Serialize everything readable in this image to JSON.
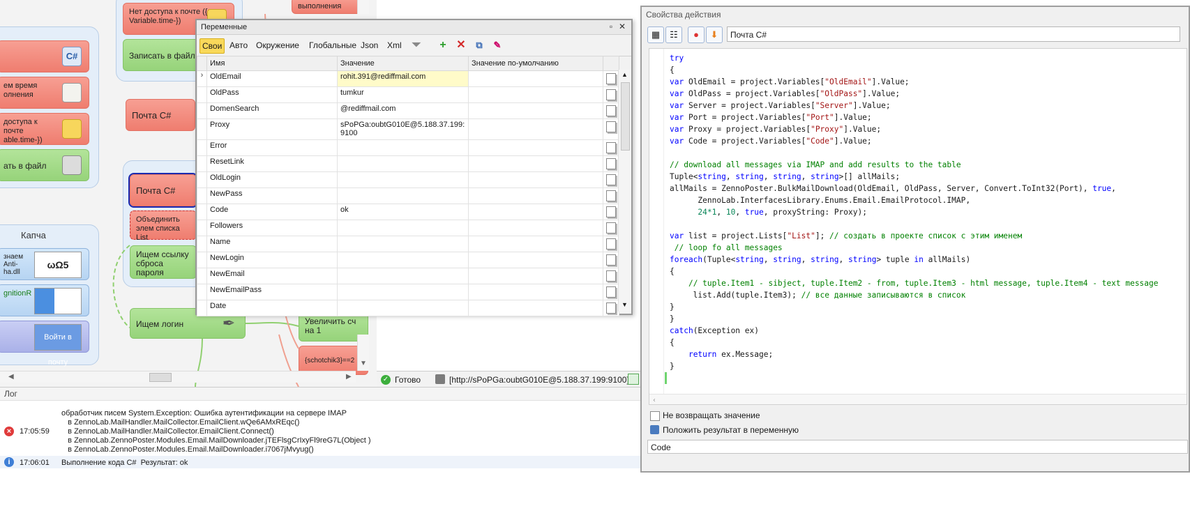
{
  "canvas": {
    "blocks": {
      "no_access_top": "Нет доступа к почте ({-Variable.time-})",
      "write_file_1": "Записать в файл",
      "execute_top": "выполнения",
      "remember_time": "ем время олнения",
      "no_access_left": "доступа к почте able.time-})",
      "write_file_left": "ать в файл",
      "mail_cs_1": "Почта C#",
      "mail_cs_2": "Почта C#",
      "merge_list": "Объединить элем списка List",
      "find_reset": "Ищем ссылку сброса пароля",
      "find_login": "Ищем логин",
      "increment": "Увеличить сч на 1",
      "condition": "{schotchik3}==2",
      "anti_captcha": "знаем Anti- ha.dll",
      "recognition": "gnitionR",
      "login_mail": "Войти в почту"
    },
    "group_captcha_title": "Капча"
  },
  "status": {
    "ready": "Готово",
    "proxy": "[http://sPoPGa:oubtG010E@5.188.37.199:9100]"
  },
  "variables_window": {
    "title": "Переменные",
    "tabs": [
      "Свои",
      "Авто",
      "Окружение",
      "Глобальные",
      "Json",
      "Xml"
    ],
    "columns": [
      "Имя",
      "Значение",
      "Значение по-умолчанию"
    ],
    "rows": [
      {
        "name": "OldEmail",
        "value": "rohit.391@rediffmail.com",
        "default": ""
      },
      {
        "name": "OldPass",
        "value": "tumkur",
        "default": ""
      },
      {
        "name": "DomenSearch",
        "value": "@rediffmail.com",
        "default": ""
      },
      {
        "name": "Proxy",
        "value": "sPoPGa:oubtG010E@5.188.37.199:9100",
        "default": ""
      },
      {
        "name": "Error",
        "value": "",
        "default": ""
      },
      {
        "name": "ResetLink",
        "value": "",
        "default": ""
      },
      {
        "name": "OldLogin",
        "value": "",
        "default": ""
      },
      {
        "name": "NewPass",
        "value": "",
        "default": ""
      },
      {
        "name": "Code",
        "value": "ok",
        "default": ""
      },
      {
        "name": "Followers",
        "value": "",
        "default": ""
      },
      {
        "name": "Name",
        "value": "",
        "default": ""
      },
      {
        "name": "NewLogin",
        "value": "",
        "default": ""
      },
      {
        "name": "NewEmail",
        "value": "",
        "default": ""
      },
      {
        "name": "NewEmailPass",
        "value": "",
        "default": ""
      },
      {
        "name": "Date",
        "value": "",
        "default": ""
      }
    ]
  },
  "properties": {
    "title": "Свойства действия",
    "action_name": "Почта C#",
    "code_lines": [
      "try",
      "{",
      "var OldEmail = project.Variables[\"OldEmail\"].Value;",
      "var OldPass = project.Variables[\"OldPass\"].Value;",
      "var Server = project.Variables[\"Server\"].Value;",
      "var Port = project.Variables[\"Port\"].Value;",
      "var Proxy = project.Variables[\"Proxy\"].Value;",
      "var Code = project.Variables[\"Code\"].Value;",
      "",
      "// download all messages via IMAP and add results to the table",
      "Tuple<string, string, string, string>[] allMails;",
      "allMails = ZennoPoster.BulkMailDownload(OldEmail, OldPass, Server, Convert.ToInt32(Port), true,",
      "      ZennoLab.InterfacesLibrary.Enums.Email.EmailProtocol.IMAP,",
      "      24*1, 10, true, proxyString: Proxy);",
      "",
      "var list = project.Lists[\"List\"]; // создать в проекте список с этим именем",
      " // loop fo all messages",
      "foreach(Tuple<string, string, string, string> tuple in allMails)",
      "{",
      "    // tuple.Item1 - sibject, tuple.Item2 - from, tuple.Item3 - html message, tuple.Item4 - text message",
      "     list.Add(tuple.Item3); // все данные записываются в список",
      "}",
      "}",
      "catch(Exception ex)",
      "{",
      "    return ex.Message;",
      "}"
    ],
    "no_return_label": "Не возвращать значение",
    "put_result_label": "Положить результат в переменную",
    "result_variable": "Code"
  },
  "log": {
    "title": "Лог",
    "entries": [
      {
        "time": "17:05:59",
        "level": "error",
        "lines": [
          "обработчик писем System.Exception: Ошибка аутентификации на сервере IMAP",
          "   в ZennoLab.MailHandler.MailCollector.EmailClient.wQe6AMxREqc()",
          "   в ZennoLab.MailHandler.MailCollector.EmailClient.Connect()",
          "   в ZennoLab.ZennoPoster.Modules.Email.MailDownloader.jTEFlsgCrIxyFl9reG7L(Object )",
          "   в ZennoLab.ZennoPoster.Modules.Email.MailDownloader.i7067jMvyug()"
        ]
      },
      {
        "time": "17:06:01",
        "level": "info",
        "lines": [
          "Выполнение кода C#  Результат: ok"
        ]
      }
    ]
  }
}
